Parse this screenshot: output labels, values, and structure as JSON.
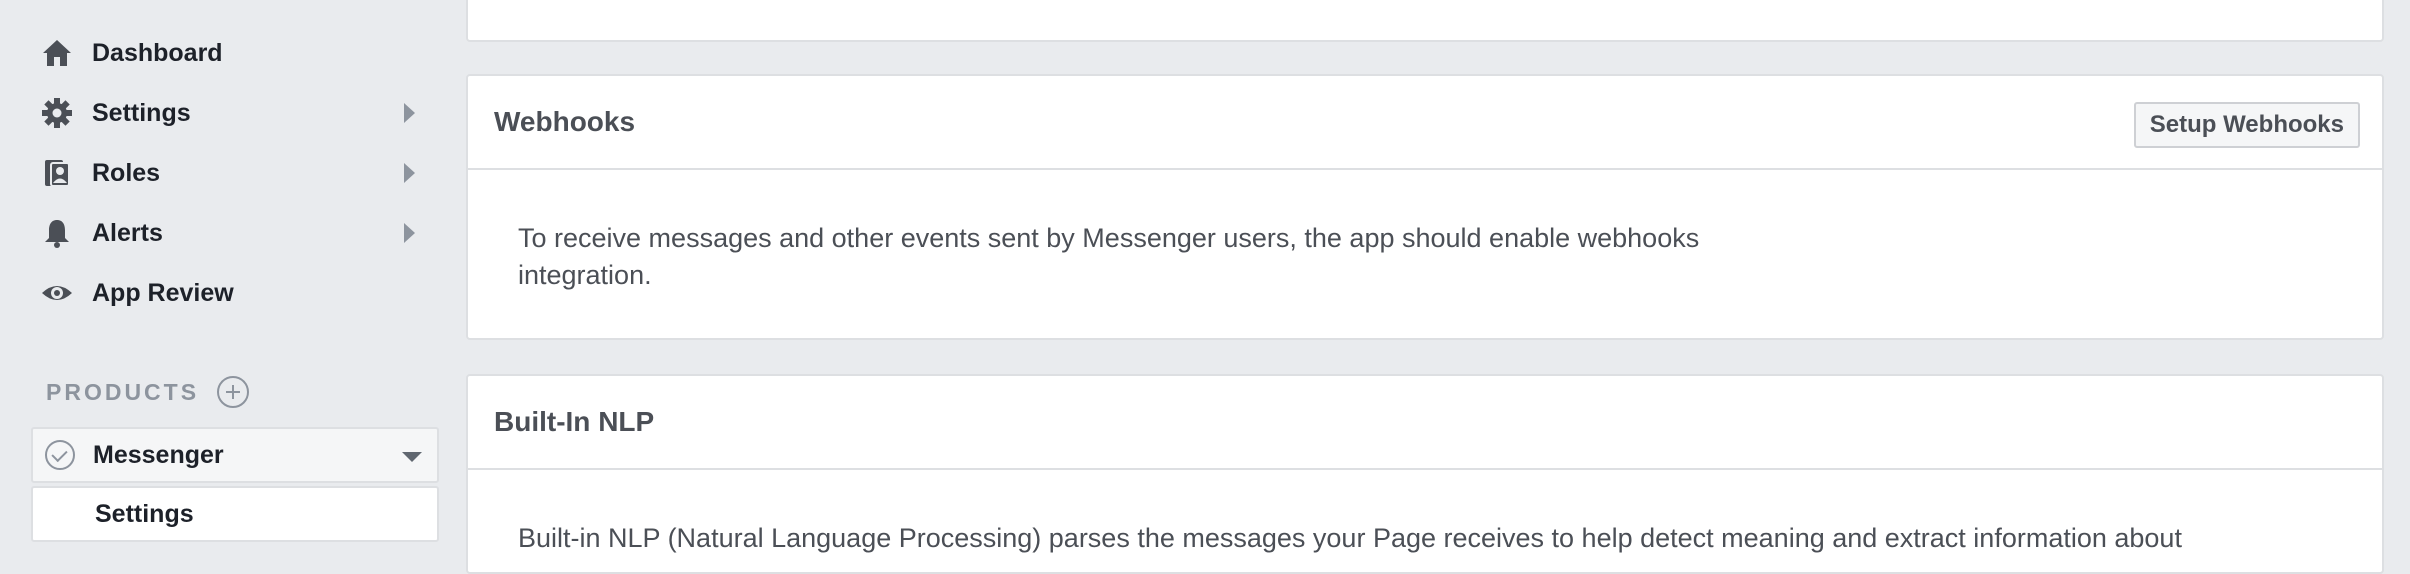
{
  "sidebar": {
    "items": [
      {
        "label": "Dashboard",
        "icon": "home-icon"
      },
      {
        "label": "Settings",
        "icon": "gear-icon"
      },
      {
        "label": "Roles",
        "icon": "roles-icon"
      },
      {
        "label": "Alerts",
        "icon": "bell-icon"
      },
      {
        "label": "App Review",
        "icon": "eye-icon"
      }
    ],
    "products_label": "PRODUCTS",
    "product": {
      "label": "Messenger"
    },
    "product_sub": {
      "label": "Settings"
    }
  },
  "webhooks": {
    "title": "Webhooks",
    "button_label": "Setup Webhooks",
    "description": "To receive messages and other events sent by Messenger users, the app should enable webhooks integration."
  },
  "nlp": {
    "title": "Built-In NLP",
    "description": "Built-in NLP (Natural Language Processing) parses the messages your Page receives to help detect meaning and extract information about"
  },
  "colors": {
    "background": "#e9ebee",
    "panel": "#ffffff",
    "border": "#dddfe2",
    "text": "#1d2129",
    "muted": "#8d949e"
  }
}
